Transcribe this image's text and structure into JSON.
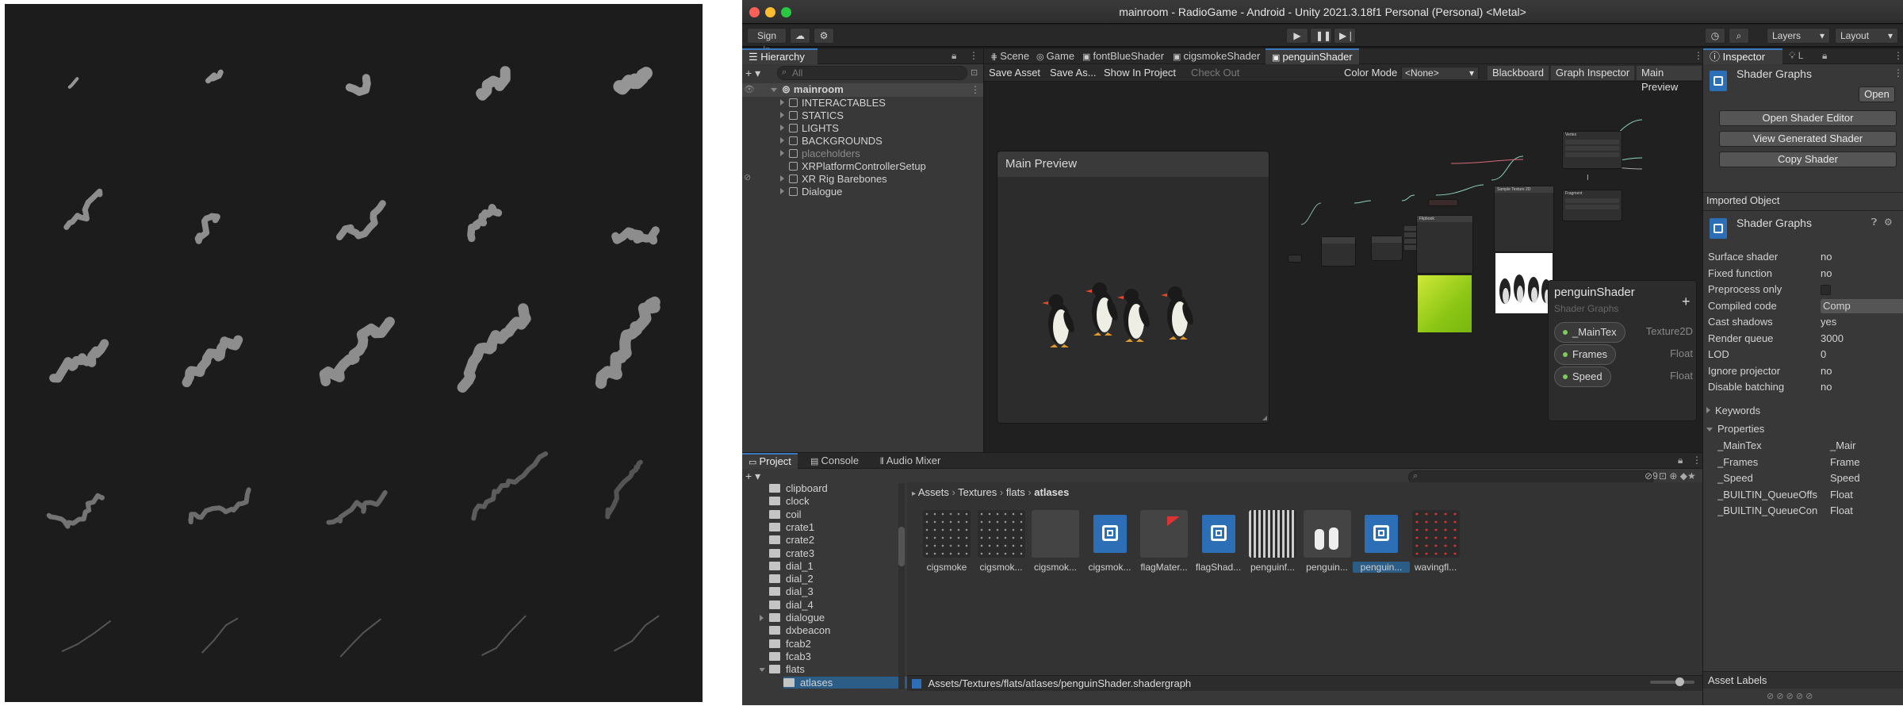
{
  "window": {
    "title": "mainroom - RadioGame - Android - Unity 2021.3.18f1 Personal (Personal) <Metal>"
  },
  "toolbar": {
    "sign_in": "Sign in",
    "layers": "Layers",
    "layout": "Layout"
  },
  "hierarchy": {
    "tab": "Hierarchy",
    "search_placeholder": "All",
    "scene": "mainroom",
    "items": [
      {
        "label": "INTERACTABLES",
        "expandable": true,
        "dim": false
      },
      {
        "label": "STATICS",
        "expandable": true,
        "dim": false
      },
      {
        "label": "LIGHTS",
        "expandable": true,
        "dim": false
      },
      {
        "label": "BACKGROUNDS",
        "expandable": true,
        "dim": false
      },
      {
        "label": "placeholders",
        "expandable": true,
        "dim": true
      },
      {
        "label": "XRPlatformControllerSetup",
        "expandable": false,
        "dim": false
      },
      {
        "label": "XR Rig Barebones",
        "expandable": true,
        "dim": false
      },
      {
        "label": "Dialogue",
        "expandable": true,
        "dim": false
      }
    ]
  },
  "center_tabs": [
    {
      "label": "Scene",
      "icon": "scene-icon",
      "active": false
    },
    {
      "label": "Game",
      "icon": "game-icon",
      "active": false
    },
    {
      "label": "fontBlueShader",
      "icon": "shader-icon",
      "active": false
    },
    {
      "label": "cigsmokeShader",
      "icon": "shader-icon",
      "active": false
    },
    {
      "label": "penguinShader",
      "icon": "shader-icon",
      "active": true
    }
  ],
  "shadergraph": {
    "save_asset": "Save Asset",
    "save_as": "Save As...",
    "show_in_project": "Show In Project",
    "check_out": "Check Out",
    "color_mode_label": "Color Mode",
    "color_mode_value": "<None>",
    "blackboard": "Blackboard",
    "graph_inspector": "Graph Inspector",
    "main_preview_btn": "Main Preview",
    "main_preview_title": "Main Preview",
    "vertex_title": "Vertex",
    "fragment_title": "Fragment",
    "sample_texture_title": "Sample Texture 2D",
    "flipbook_title": "Flipbook",
    "blackboard_panel": {
      "title": "penguinShader",
      "subtitle": "Shader Graphs",
      "properties": [
        {
          "name": "_MainTex",
          "type": "Texture2D"
        },
        {
          "name": "Frames",
          "type": "Float"
        },
        {
          "name": "Speed",
          "type": "Float"
        }
      ]
    }
  },
  "bottom_tabs": [
    {
      "label": "Project",
      "active": true
    },
    {
      "label": "Console",
      "active": false
    },
    {
      "label": "Audio Mixer",
      "active": false
    }
  ],
  "project": {
    "folders": [
      {
        "label": "clipboard",
        "indent": 1,
        "expand": "none"
      },
      {
        "label": "clock",
        "indent": 1,
        "expand": "none"
      },
      {
        "label": "coil",
        "indent": 1,
        "expand": "none"
      },
      {
        "label": "crate1",
        "indent": 1,
        "expand": "none"
      },
      {
        "label": "crate2",
        "indent": 1,
        "expand": "none"
      },
      {
        "label": "crate3",
        "indent": 1,
        "expand": "none"
      },
      {
        "label": "dial_1",
        "indent": 1,
        "expand": "none"
      },
      {
        "label": "dial_2",
        "indent": 1,
        "expand": "none"
      },
      {
        "label": "dial_3",
        "indent": 1,
        "expand": "none"
      },
      {
        "label": "dial_4",
        "indent": 1,
        "expand": "none"
      },
      {
        "label": "dialogue",
        "indent": 1,
        "expand": "closed"
      },
      {
        "label": "dxbeacon",
        "indent": 1,
        "expand": "none"
      },
      {
        "label": "fcab2",
        "indent": 1,
        "expand": "none"
      },
      {
        "label": "fcab3",
        "indent": 1,
        "expand": "none"
      },
      {
        "label": "flats",
        "indent": 1,
        "expand": "open"
      },
      {
        "label": "atlases",
        "indent": 2,
        "expand": "none"
      }
    ],
    "breadcrumb": [
      "Assets",
      "Textures",
      "flats",
      "atlases"
    ],
    "assets": [
      {
        "label": "cigsmoke",
        "kind": "dots"
      },
      {
        "label": "cigsmok...",
        "kind": "dots"
      },
      {
        "label": "cigsmok...",
        "kind": "plain"
      },
      {
        "label": "cigsmok...",
        "kind": "shader"
      },
      {
        "label": "flagMater...",
        "kind": "flag"
      },
      {
        "label": "flagShad...",
        "kind": "shader"
      },
      {
        "label": "penguinf...",
        "kind": "strip"
      },
      {
        "label": "penguin...",
        "kind": "penguin"
      },
      {
        "label": "penguin...",
        "kind": "shader-selected"
      },
      {
        "label": "wavingfl...",
        "kind": "red"
      }
    ],
    "path": "Assets/Textures/flats/atlases/penguinShader.shadergraph",
    "hidden_count": "9"
  },
  "inspector": {
    "tab": "Inspector",
    "title": "Shader Graphs",
    "open": "Open",
    "buttons": [
      "Open Shader Editor",
      "View Generated Shader",
      "Copy Shader"
    ],
    "imported_object": "Imported Object",
    "imported_title": "Shader Graphs",
    "rows": [
      {
        "label": "Surface shader",
        "value": "no"
      },
      {
        "label": "Fixed function",
        "value": "no"
      },
      {
        "label": "Preprocess only",
        "value": ""
      },
      {
        "label": "Compiled code",
        "value": "Comp"
      },
      {
        "label": "Cast shadows",
        "value": "yes"
      },
      {
        "label": "Render queue",
        "value": "3000"
      },
      {
        "label": "LOD",
        "value": "0"
      },
      {
        "label": "Ignore projector",
        "value": "no"
      },
      {
        "label": "Disable batching",
        "value": "no"
      }
    ],
    "keywords": "Keywords",
    "properties": "Properties",
    "prop_rows": [
      {
        "label": "_MainTex",
        "value": "_Mair"
      },
      {
        "label": "_Frames",
        "value": "Frame"
      },
      {
        "label": "_Speed",
        "value": "Speed"
      },
      {
        "label": "_BUILTIN_QueueOffs",
        "value": "Float"
      },
      {
        "label": "_BUILTIN_QueueCon",
        "value": "Float"
      }
    ],
    "asset_labels": "Asset Labels"
  }
}
